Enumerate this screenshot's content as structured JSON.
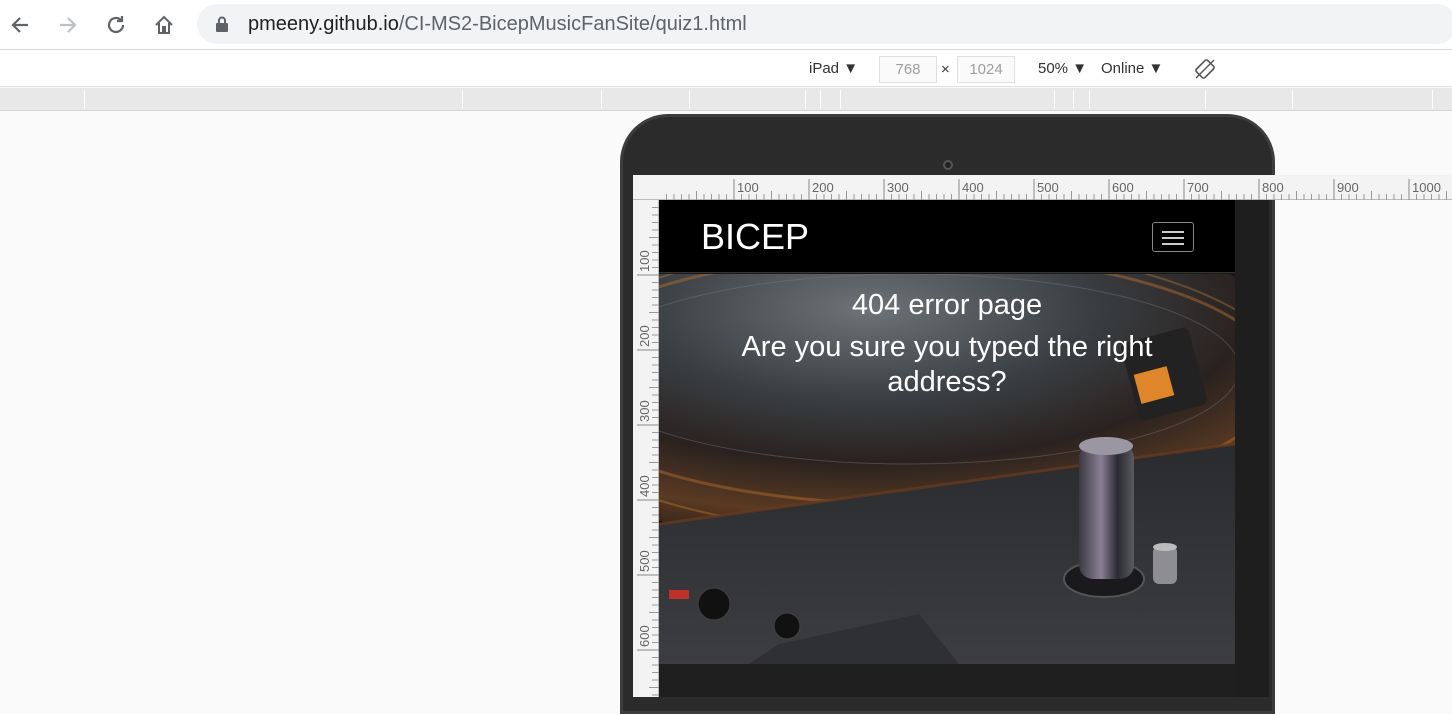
{
  "browser": {
    "url_host": "pmeeny.github.io",
    "url_path": "/CI-MS2-BicepMusicFanSite/quiz1.html"
  },
  "device_toolbar": {
    "device": "iPad",
    "width": "768",
    "times": "×",
    "height": "1024",
    "zoom": "50%",
    "network": "Online"
  },
  "ruler": {
    "h_labels": [
      "100",
      "200",
      "300",
      "400",
      "500",
      "600",
      "700",
      "800",
      "900",
      "1000"
    ],
    "v_labels": [
      "100",
      "200",
      "300",
      "400",
      "500",
      "600"
    ]
  },
  "site": {
    "brand": "BICEP",
    "heading": "404 error page",
    "subheading_line1": "Are you sure you typed the right",
    "subheading_line2": "address?"
  },
  "colors": {
    "nav_bg": "#000000",
    "text": "#ffffff",
    "accent_orange": "#e0862a"
  }
}
